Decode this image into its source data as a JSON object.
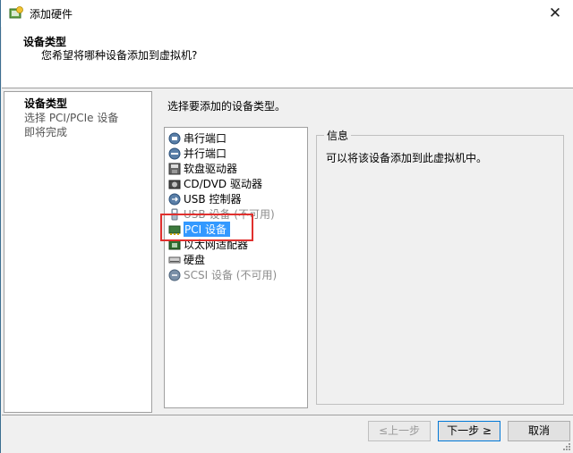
{
  "window": {
    "title": "添加硬件",
    "close_glyph": "✕"
  },
  "header": {
    "title": "设备类型",
    "subtitle": "您希望将哪种设备添加到虚拟机?"
  },
  "steps": [
    {
      "label": "设备类型",
      "active": true
    },
    {
      "label": "选择 PCI/PCIe 设备",
      "active": false
    },
    {
      "label": "即将完成",
      "active": false
    }
  ],
  "device_list": {
    "prompt": "选择要添加的设备类型。",
    "items": [
      {
        "label": "串行端口",
        "icon": "serial-port-icon",
        "disabled": false,
        "selected": false
      },
      {
        "label": "并行端口",
        "icon": "parallel-port-icon",
        "disabled": false,
        "selected": false
      },
      {
        "label": "软盘驱动器",
        "icon": "floppy-drive-icon",
        "disabled": false,
        "selected": false
      },
      {
        "label": "CD/DVD 驱动器",
        "icon": "cd-dvd-drive-icon",
        "disabled": false,
        "selected": false
      },
      {
        "label": "USB 控制器",
        "icon": "usb-controller-icon",
        "disabled": false,
        "selected": false
      },
      {
        "label": "USB 设备 (不可用)",
        "icon": "usb-device-icon",
        "disabled": true,
        "selected": false
      },
      {
        "label": "PCI 设备",
        "icon": "pci-device-icon",
        "disabled": false,
        "selected": true
      },
      {
        "label": "以太网适配器",
        "icon": "ethernet-adapter-icon",
        "disabled": false,
        "selected": false
      },
      {
        "label": "硬盘",
        "icon": "hard-disk-icon",
        "disabled": false,
        "selected": false
      },
      {
        "label": "SCSI 设备 (不可用)",
        "icon": "scsi-device-icon",
        "disabled": true,
        "selected": false
      }
    ]
  },
  "info": {
    "legend": "信息",
    "text": "可以将该设备添加到此虚拟机中。"
  },
  "buttons": {
    "back": {
      "label": "≤上一步",
      "disabled": true
    },
    "next": {
      "label": "下一步 ≥",
      "disabled": false
    },
    "cancel": {
      "label": "取消",
      "disabled": false
    }
  },
  "colors": {
    "selection": "#3399ff",
    "highlight_box": "#e0302e",
    "window_bg": "#f0f0f0"
  }
}
